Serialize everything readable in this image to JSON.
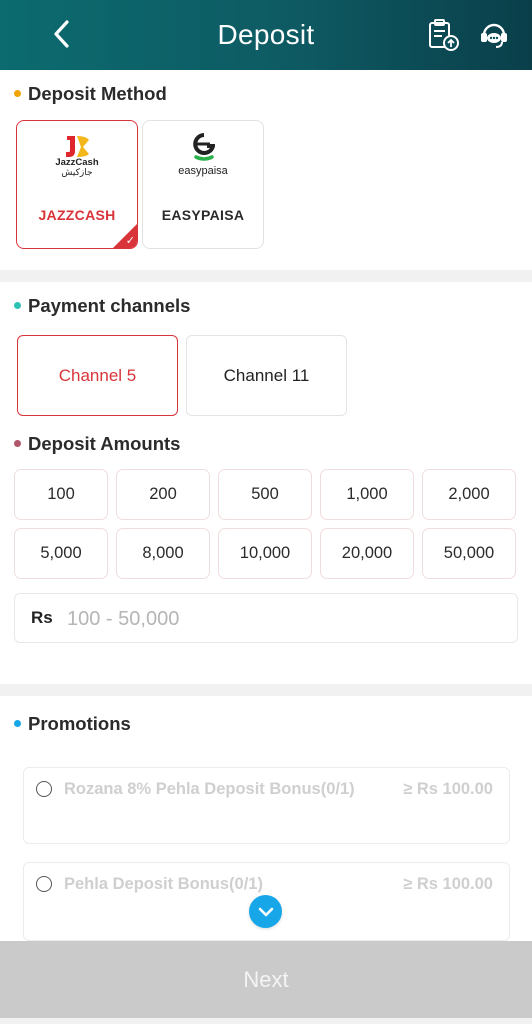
{
  "header": {
    "title": "Deposit",
    "icons": [
      "back-arrow-icon",
      "deposit-record-icon",
      "customer-service-icon"
    ]
  },
  "deposit_method": {
    "title": "Deposit Method",
    "dot_color": "#f0a500",
    "options": [
      {
        "label": "JAZZCASH",
        "logo_text": "JazzCash",
        "logo_subtext": "جازکیش",
        "selected": true,
        "label_color": "#d9343a"
      },
      {
        "label": "EASYPAISA",
        "logo_text": "easypaisa",
        "selected": false,
        "label_color": "#2b2b2b"
      }
    ]
  },
  "payment_channels": {
    "title": "Payment channels",
    "dot_color": "#2fc1b4",
    "options": [
      {
        "label": "Channel 5",
        "selected": true
      },
      {
        "label": "Channel 11",
        "selected": false
      }
    ]
  },
  "deposit_amounts": {
    "title": "Deposit Amounts",
    "dot_color": "#b0566a",
    "amounts": [
      "100",
      "200",
      "500",
      "1,000",
      "2,000",
      "5,000",
      "8,000",
      "10,000",
      "20,000",
      "50,000"
    ],
    "currency": "Rs",
    "input_value": "",
    "input_placeholder": "100 - 50,000"
  },
  "promotions": {
    "title": "Promotions",
    "dot_color": "#17a6e8",
    "items": [
      {
        "name": "Rozana 8% Pehla Deposit Bonus(0/1)",
        "min": "≥ Rs 100.00"
      },
      {
        "name": "Pehla Deposit Bonus(0/1)",
        "min": "≥ Rs 100.00"
      }
    ]
  },
  "footer": {
    "next_label": "Next"
  },
  "colors": {
    "header_start": "#0b6b6e",
    "header_end": "#0a3f4a",
    "accent_red": "#d9343a",
    "expand_blue": "#17a6e8",
    "disabled_button": "#cacaca"
  }
}
